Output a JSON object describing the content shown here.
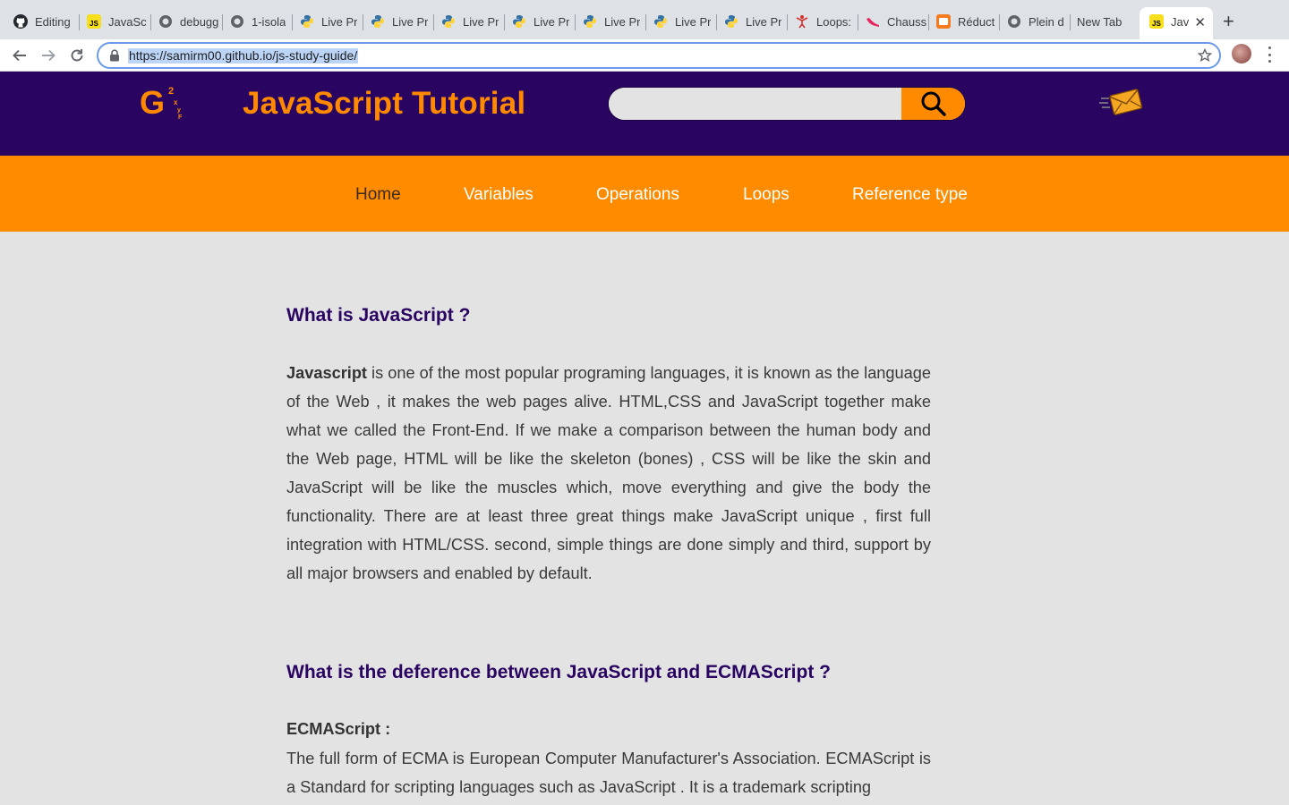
{
  "browser": {
    "tabs": [
      {
        "label": "Editing",
        "icon": "github-icon"
      },
      {
        "label": "JavaSc",
        "icon": "js-icon"
      },
      {
        "label": "debugg",
        "icon": "globe-icon"
      },
      {
        "label": "1-isola",
        "icon": "globe-icon"
      },
      {
        "label": "Live Pr",
        "icon": "python-icon"
      },
      {
        "label": "Live Pr",
        "icon": "python-icon"
      },
      {
        "label": "Live Pr",
        "icon": "python-icon"
      },
      {
        "label": "Live Pr",
        "icon": "python-icon"
      },
      {
        "label": "Live Pr",
        "icon": "python-icon"
      },
      {
        "label": "Live Pr",
        "icon": "python-icon"
      },
      {
        "label": "Live Pr",
        "icon": "python-icon"
      },
      {
        "label": "Loops:",
        "icon": "figure-icon"
      },
      {
        "label": "Chauss",
        "icon": "shoe-icon"
      },
      {
        "label": "Réduct",
        "icon": "orange-square-icon"
      },
      {
        "label": "Plein d",
        "icon": "globe-icon"
      },
      {
        "label": "New Tab",
        "icon": ""
      },
      {
        "label": "Jav",
        "icon": "js-icon",
        "active": true
      }
    ],
    "url": "https://samirm00.github.io/js-study-guide/"
  },
  "header": {
    "title": "JavaScript Tutorial",
    "search_placeholder": ""
  },
  "nav": {
    "items": [
      "Home",
      "Variables",
      "Operations",
      "Loops",
      "Reference type"
    ],
    "active": "Home"
  },
  "content": {
    "section1_title": "What is JavaScript ?",
    "section1_lead": "Javascript",
    "section1_body": " is one of the most popular programing languages, it is known as the language of the Web , it makes the web pages alive. HTML,CSS and JavaScript together make what we called the Front-End. If we make a comparison between the human body and the Web page, HTML will be like the skeleton (bones) , CSS will be like the skin and JavaScript will be like the muscles which, move everything and give the body the functionality. There are at least three great things make JavaScript unique , first full integration with HTML/CSS. second, simple things are done simply and third, support by all major browsers and enabled by default.",
    "section2_title": "What is the deference between JavaScript and ECMAScript ?",
    "ecma_heading": "ECMAScript :",
    "ecma_body": "The full form of ECMA is European Computer Manufacturer's Association. ECMAScript is a Standard for scripting languages such as JavaScript . It is a trademark scripting"
  },
  "colors": {
    "header_bg": "#2a0461",
    "accent_orange": "#ff8c00",
    "page_bg": "#e3e3e3",
    "heading_purple": "#2a0461"
  }
}
